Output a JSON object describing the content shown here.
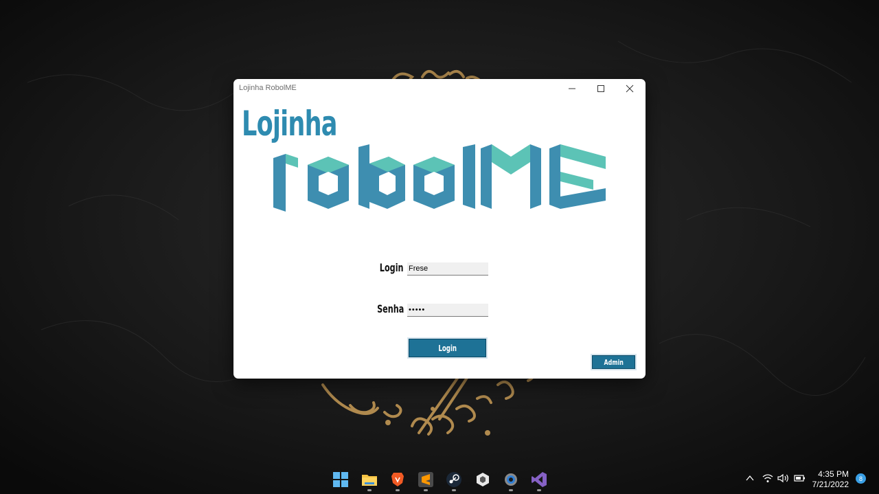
{
  "window": {
    "title": "Lojinha RobolME",
    "brand_top": "Lojinha",
    "brand_main": "robolME",
    "accent_color": "#2e8bb0",
    "accent_light": "#5cc3b6"
  },
  "form": {
    "login_label": "Login",
    "login_value": "Frese",
    "password_label": "Senha",
    "password_value": "•••••",
    "login_button": "Login",
    "admin_button": "Admin"
  },
  "taskbar": {
    "apps": [
      "start-icon",
      "file-explorer-icon",
      "brave-icon",
      "sublime-text-icon",
      "steam-icon",
      "unity-icon",
      "settings-icon",
      "visual-studio-icon"
    ],
    "time": "4:35 PM",
    "date": "7/21/2022",
    "notifications": "8"
  }
}
